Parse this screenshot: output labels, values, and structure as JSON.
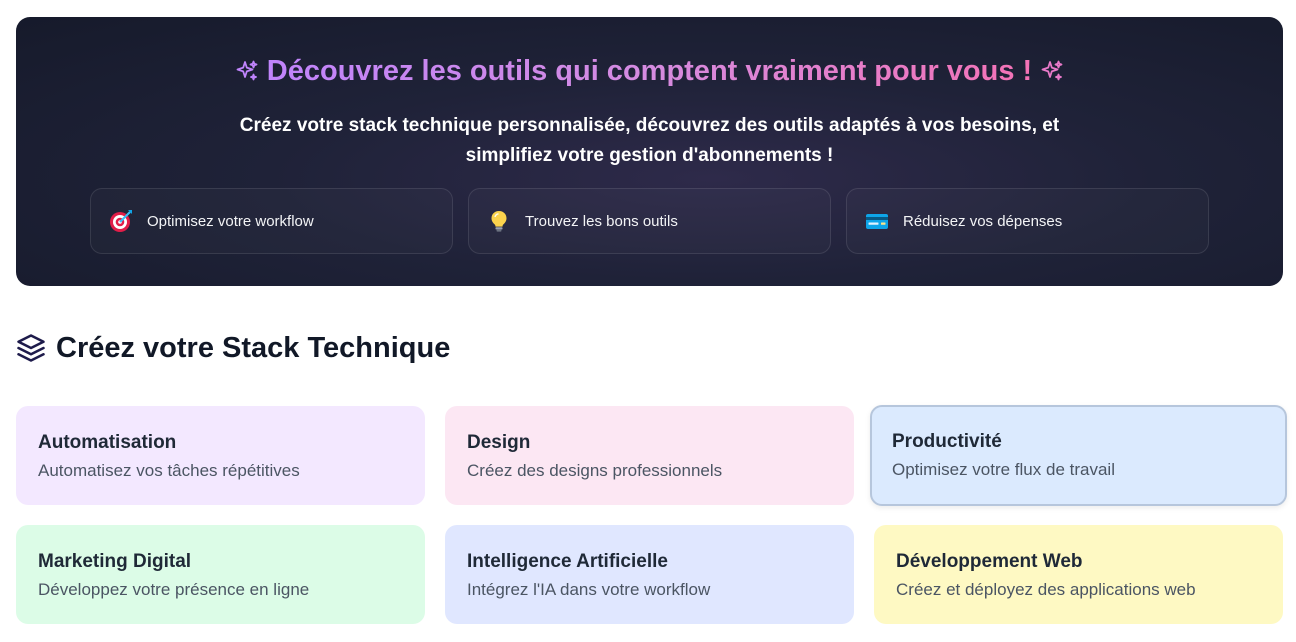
{
  "hero": {
    "title": "Découvrez les outils qui comptent vraiment pour vous !",
    "subtitle": "Créez votre stack technique personnalisée, découvrez des outils adaptés à vos besoins, et simplifiez votre gestion d'abonnements !",
    "features": [
      {
        "label": "Optimisez votre workflow",
        "icon": "target-icon"
      },
      {
        "label": "Trouvez les bons outils",
        "icon": "lightbulb-icon"
      },
      {
        "label": "Réduisez vos dépenses",
        "icon": "credit-card-icon"
      }
    ]
  },
  "section": {
    "title": "Créez votre Stack Technique",
    "icon": "layers-icon"
  },
  "categories": [
    {
      "title": "Automatisation",
      "description": "Automatisez vos tâches répétitives",
      "color": "#f3e8ff"
    },
    {
      "title": "Design",
      "description": "Créez des designs professionnels",
      "color": "#fce7f3"
    },
    {
      "title": "Productivité",
      "description": "Optimisez votre flux de travail",
      "color": "#dbeafe",
      "selected": true
    },
    {
      "title": "Marketing Digital",
      "description": "Développez votre présence en ligne",
      "color": "#dcfce7"
    },
    {
      "title": "Intelligence Artificielle",
      "description": "Intégrez l'IA dans votre workflow",
      "color": "#e0e7ff"
    },
    {
      "title": "Développement Web",
      "description": "Créez et déployez des applications web",
      "color": "#fef9c3"
    }
  ]
}
